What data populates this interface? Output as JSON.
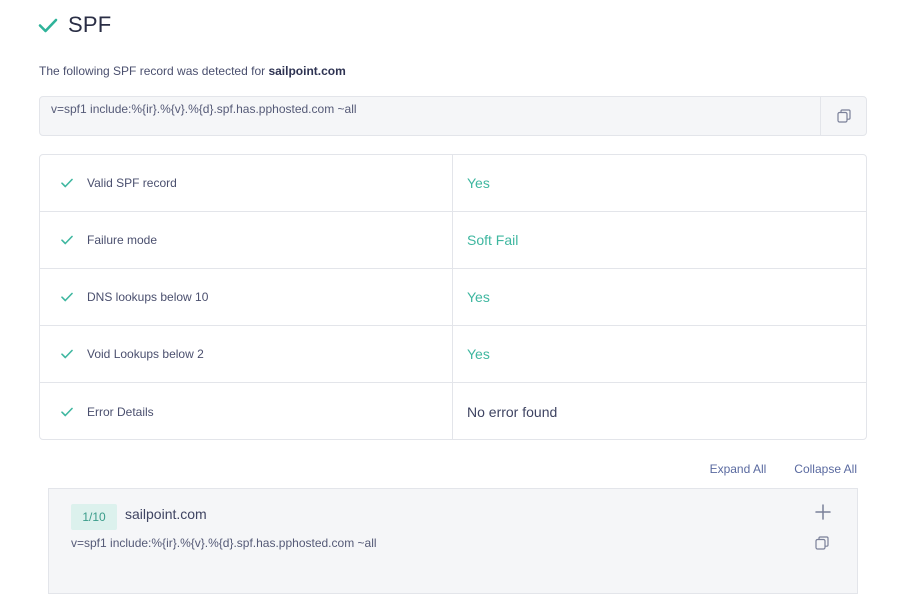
{
  "header": {
    "title": "SPF",
    "check_icon": "check-icon",
    "accent": "#2fb39a"
  },
  "detected": {
    "prefix": "The following SPF record was detected for ",
    "domain": "sailpoint.com"
  },
  "record": {
    "text": "v=spf1 include:%{ir}.%{v}.%{d}.spf.has.pphosted.com ~all",
    "copy_icon": "copy-icon"
  },
  "checks": [
    {
      "label": "Valid SPF record",
      "value": "Yes",
      "status": "ok"
    },
    {
      "label": "Failure mode",
      "value": "Soft Fail",
      "status": "ok"
    },
    {
      "label": "DNS lookups below 10",
      "value": "Yes",
      "status": "ok"
    },
    {
      "label": "Void Lookups below 2",
      "value": "Yes",
      "status": "ok"
    },
    {
      "label": "Error Details",
      "value": "No error found",
      "status": "plain"
    }
  ],
  "links": {
    "expand_all": "Expand All",
    "collapse_all": "Collapse All"
  },
  "card": {
    "badge": "1/10",
    "domain": "sailpoint.com",
    "record": "v=spf1 include:%{ir}.%{v}.%{d}.spf.has.pphosted.com ~all",
    "expand_icon": "plus-icon",
    "copy_icon": "copy-icon"
  },
  "colors": {
    "ok": "#3fb7a0",
    "border": "#e3e5ea",
    "panel_bg": "#f5f6f8",
    "badge_bg": "#dcf1ed"
  }
}
